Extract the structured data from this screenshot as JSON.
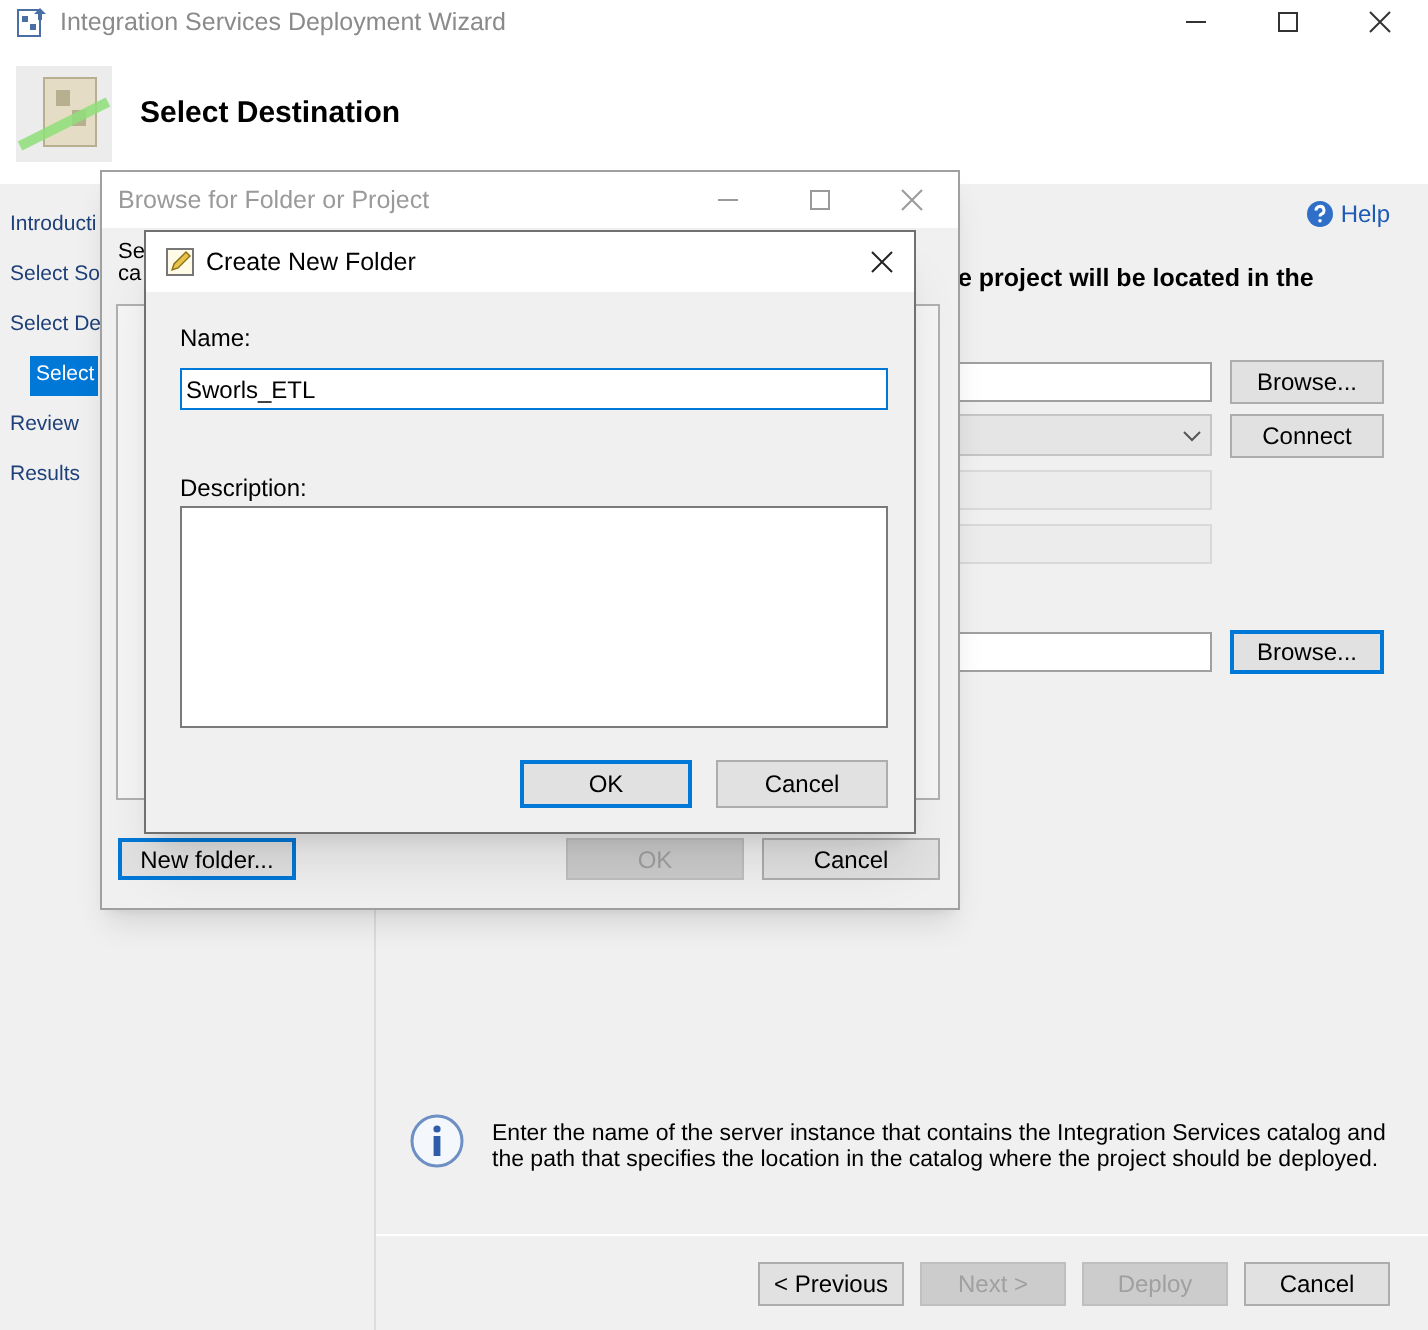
{
  "window": {
    "title": "Integration Services Deployment Wizard"
  },
  "header": {
    "title": "Select Destination"
  },
  "sidebar": {
    "items": [
      {
        "label": "Introducti",
        "selected": false
      },
      {
        "label": "Select So",
        "selected": false
      },
      {
        "label": "Select De",
        "selected": false,
        "children": [
          {
            "label": "Select",
            "selected": true
          }
        ]
      },
      {
        "label": "Review",
        "selected": false
      },
      {
        "label": "Results",
        "selected": false
      }
    ]
  },
  "help": {
    "label": "Help"
  },
  "instructions": "e project will be located in the",
  "server_fields": [
    {
      "kind": "text",
      "button": {
        "label": "Browse...",
        "focused": false
      }
    },
    {
      "kind": "combo",
      "button": {
        "label": "Connect",
        "focused": false
      }
    },
    {
      "kind": "disabled"
    },
    {
      "kind": "disabled"
    }
  ],
  "path_fields": [
    {
      "kind": "text",
      "button": {
        "label": "Browse...",
        "focused": true
      }
    }
  ],
  "info": {
    "text": "Enter the name of the server instance that contains the Integration Services catalog and the path that specifies the location in the catalog where the project should be deployed."
  },
  "nav_buttons": [
    {
      "label": "< Previous",
      "disabled": false
    },
    {
      "label": "Next >",
      "disabled": true
    },
    {
      "label": "Deploy",
      "disabled": true
    },
    {
      "label": "Cancel",
      "disabled": false
    }
  ],
  "browse_dialog": {
    "title": "Browse for Folder or Project",
    "text_lines": [
      "Se",
      "ca"
    ],
    "buttons": [
      {
        "label": "New folder...",
        "disabled": false,
        "focused": true
      },
      {
        "label": "OK",
        "disabled": true,
        "focused": false
      },
      {
        "label": "Cancel",
        "disabled": false,
        "focused": false
      }
    ]
  },
  "create_dialog": {
    "title": "Create New Folder",
    "name_label": "Name:",
    "name_value": "Sworls_ETL",
    "description_label": "Description:",
    "buttons": [
      {
        "label": "OK",
        "disabled": false,
        "focused": true
      },
      {
        "label": "Cancel",
        "disabled": false,
        "focused": false
      }
    ]
  }
}
